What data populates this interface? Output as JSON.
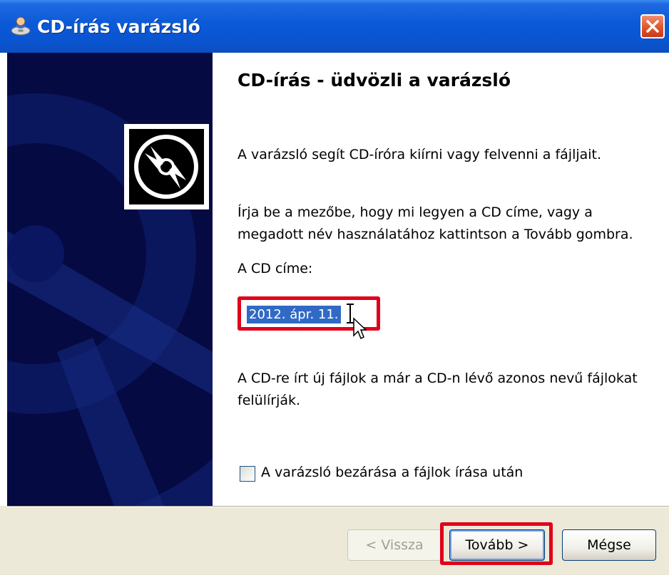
{
  "window": {
    "title": "CD-írás varázsló",
    "colors": {
      "titlebar": "#0a5ad8",
      "banner": "#050a42",
      "highlight": "#e0001a",
      "selection": "#316ac5"
    }
  },
  "content": {
    "heading": "CD-írás - üdvözli a varázsló",
    "intro": "A varázsló segít CD-íróra kiírni vagy felvenni a fájljait.",
    "instruction": "Írja be a mezőbe, hogy mi legyen a CD címe, vagy a megadott név használatához kattintson a Tovább gombra.",
    "cd_title_label": "A CD címe:",
    "cd_title_value": "2012. ápr. 11.",
    "overwrite_note": "A CD-re írt új fájlok a már a CD-n lévő azonos nevű fájlokat felülírják.",
    "close_checkbox_label": "A varázsló bezárása a fájlok írása után",
    "close_checkbox_checked": false
  },
  "buttons": {
    "back": "< Vissza",
    "next": "Tovább >",
    "cancel": "Mégse"
  },
  "icons": {
    "title": "cd-burner-icon",
    "close": "close-icon",
    "banner": "cd-disc-icon"
  }
}
